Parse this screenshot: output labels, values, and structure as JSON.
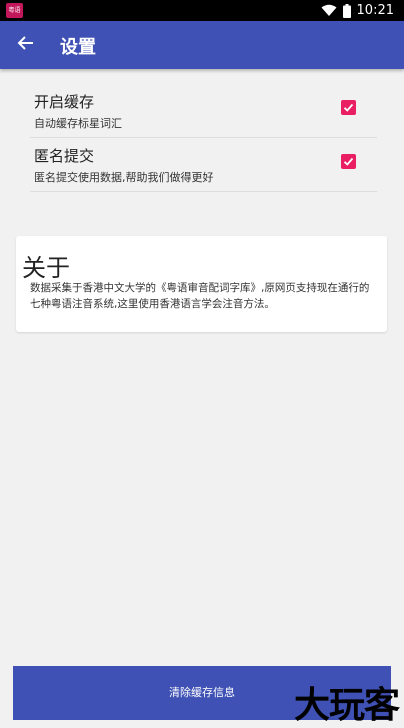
{
  "statusbar": {
    "app_badge": "粤语",
    "time": "10:21"
  },
  "appbar": {
    "title": "设置",
    "back_icon": "arrow-back-icon"
  },
  "settings": [
    {
      "title": "开启缓存",
      "subtitle": "自动缓存标星词汇",
      "checked": true
    },
    {
      "title": "匿名提交",
      "subtitle": "匿名提交使用数据,帮助我们做得更好",
      "checked": true
    }
  ],
  "about": {
    "title": "关于",
    "body": "数据采集于香港中文大学的《粤语审音配词字库》,原网页支持现在通行的七种粤语注音系统,这里使用香港语言学会注音方法。"
  },
  "footer": {
    "clear_cache_label": "清除缓存信息"
  },
  "watermark": {
    "text": "大玩客"
  },
  "colors": {
    "primary": "#3f51b5",
    "accent": "#e91e63",
    "background": "#f1f1f1"
  }
}
